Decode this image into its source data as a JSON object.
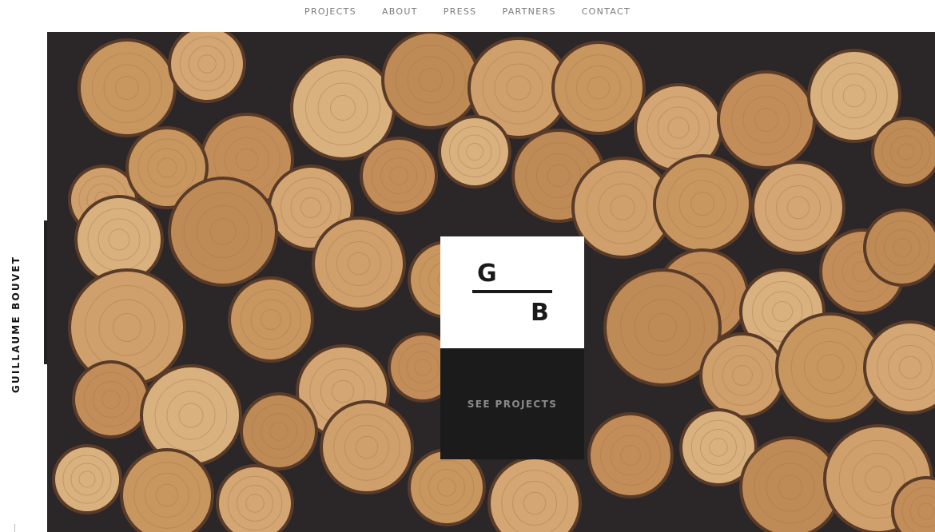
{
  "nav": {
    "items": [
      "PROJECTS",
      "ABOUT",
      "PRESS",
      "PARTNERS",
      "CONTACT"
    ]
  },
  "sidebar": {
    "brand": "GUILLAUME BOUVET"
  },
  "hero": {
    "image": "stacked-wooden-logs-photo",
    "logo": {
      "top": "G",
      "bottom": "B"
    },
    "cta_label": "SEE PROJECTS"
  },
  "colors": {
    "nav_text": "#7a7a7a",
    "brand_text": "#111111",
    "logo_bg": "#ffffff",
    "cta_bg": "#1c1b1c",
    "cta_text": "#8a8a8a",
    "wood": "#c99a66"
  }
}
